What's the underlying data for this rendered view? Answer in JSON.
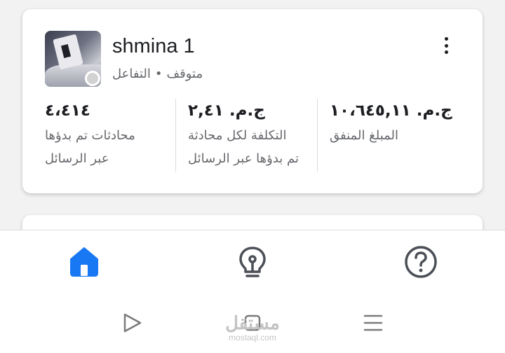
{
  "colors": {
    "accent": "#1877f2",
    "text_primary": "#1c1e21",
    "text_secondary": "#65676b",
    "status_inactive": "#d2d2d2",
    "icon_gray": "#4b4f56"
  },
  "card": {
    "thumbnail_icon": "ad-thumbnail-image",
    "title": "shmina 1",
    "status_label": "متوقف",
    "separator": "•",
    "type_label": "التفاعل",
    "more_icon": "kebab-vertical-icon"
  },
  "metrics": [
    {
      "value": "٤،٤١٤",
      "label_line1": "محادثات تم بدؤها",
      "label_line2": "عبر الرسائل"
    },
    {
      "value": "ج.م. ٢,٤١",
      "label_line1": "التكلفة لكل محادثة",
      "label_line2": "تم بدؤها عبر الرسائل"
    },
    {
      "value": "ج.م. ١٠،٦٤٥,١١",
      "label_line1": "المبلغ المنفق",
      "label_line2": ""
    }
  ],
  "bottom_nav": {
    "items": [
      {
        "icon": "home-icon",
        "active": true
      },
      {
        "icon": "lightbulb-icon",
        "active": false
      },
      {
        "icon": "help-circle-icon",
        "active": false
      }
    ]
  },
  "system_nav": {
    "items": [
      {
        "icon": "back-triangle-icon"
      },
      {
        "icon": "recent-apps-icon"
      },
      {
        "icon": "menu-lines-icon"
      }
    ]
  },
  "watermark": {
    "arabic": "مستقل",
    "latin": "mostaql.com"
  }
}
